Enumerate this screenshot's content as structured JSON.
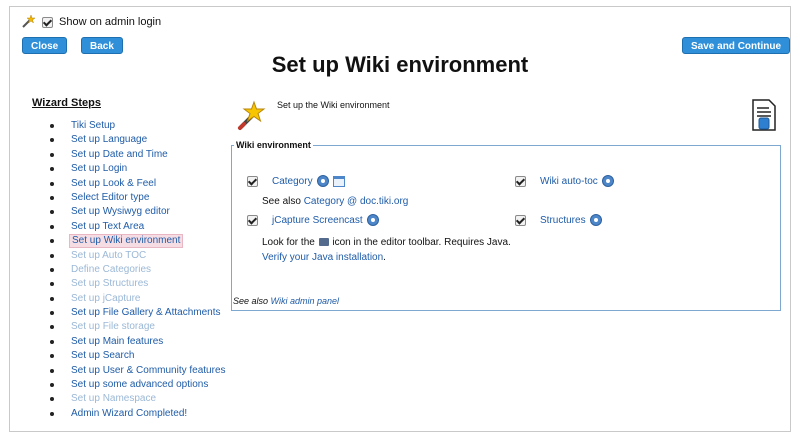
{
  "topbar": {
    "show_admin_login_label": "Show on admin login",
    "show_admin_login_checked": true
  },
  "buttons": {
    "close": "Close",
    "back": "Back",
    "save_continue": "Save and Continue"
  },
  "page_title": "Set up Wiki environment",
  "wizard": {
    "heading": "Wizard Steps",
    "steps": [
      {
        "label": "Tiki Setup",
        "state": "link"
      },
      {
        "label": "Set up Language",
        "state": "link"
      },
      {
        "label": "Set up Date and Time",
        "state": "link"
      },
      {
        "label": "Set up Login",
        "state": "link"
      },
      {
        "label": "Set up Look & Feel",
        "state": "link"
      },
      {
        "label": "Select Editor type",
        "state": "link"
      },
      {
        "label": "Set up Wysiwyg editor",
        "state": "link"
      },
      {
        "label": "Set up Text Area",
        "state": "link"
      },
      {
        "label": "Set up Wiki environment",
        "state": "current"
      },
      {
        "label": "Set up Auto TOC",
        "state": "muted"
      },
      {
        "label": "Define Categories",
        "state": "muted"
      },
      {
        "label": "Set up Structures",
        "state": "muted"
      },
      {
        "label": "Set up jCapture",
        "state": "muted"
      },
      {
        "label": "Set up File Gallery & Attachments",
        "state": "link"
      },
      {
        "label": "Set up File storage",
        "state": "muted"
      },
      {
        "label": "Set up Main features",
        "state": "link"
      },
      {
        "label": "Set up Search",
        "state": "link"
      },
      {
        "label": "Set up User & Community features",
        "state": "link"
      },
      {
        "label": "Set up some advanced options",
        "state": "link"
      },
      {
        "label": "Set up Namespace",
        "state": "muted"
      },
      {
        "label": "Admin Wizard Completed!",
        "state": "link"
      }
    ]
  },
  "intro_text": "Set up the Wiki environment",
  "wiki_env": {
    "legend": "Wiki environment",
    "category": {
      "label": "Category",
      "checked": true
    },
    "see_also_prefix": "See also ",
    "see_also_link": "Category @ doc.tiki.org",
    "wiki_autotoc": {
      "label": "Wiki auto-toc",
      "checked": true
    },
    "jcapture": {
      "label": "jCapture Screencast",
      "checked": true
    },
    "structures": {
      "label": "Structures",
      "checked": true
    },
    "look_for_before": "Look for the ",
    "look_for_after": " icon in the editor toolbar. Requires Java.",
    "verify_java": "Verify your Java installation",
    "verify_java_suffix": ".",
    "see_also_admin_prefix": "See also ",
    "see_also_admin_link": "Wiki admin panel"
  },
  "icons": {
    "wizard": "magic-wand-icon",
    "document": "document-icon",
    "help": "help-icon",
    "category_browse": "calendar-icon",
    "toolbar": "jcapture-toolbar-icon"
  },
  "colors": {
    "button": "#2f8fd8",
    "link": "#1f5ca8",
    "muted_link": "#9bb8d6",
    "current_bg": "#f6dde3",
    "fieldset_border": "#7fa8d0"
  }
}
